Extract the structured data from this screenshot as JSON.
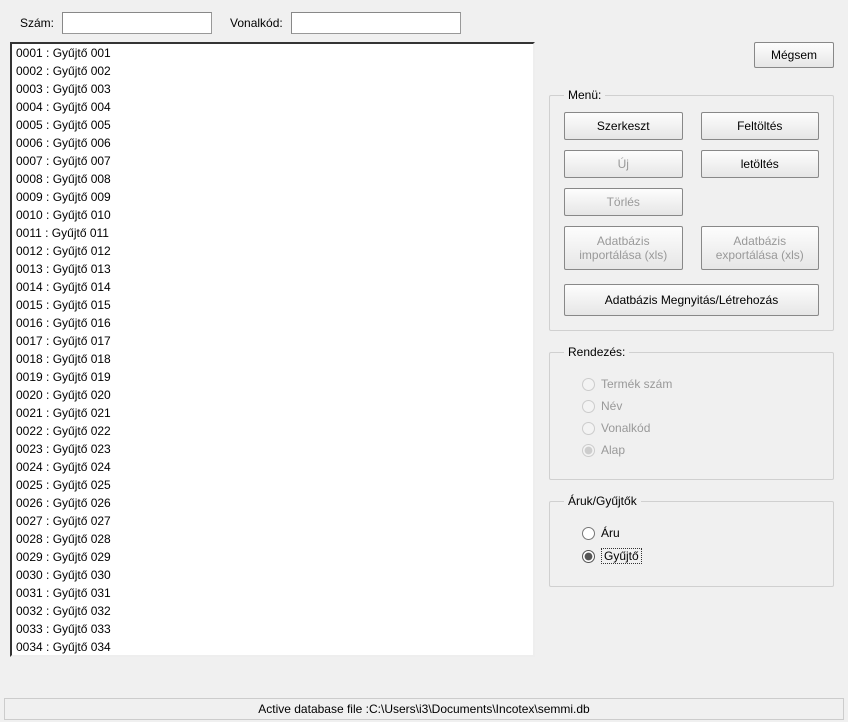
{
  "top": {
    "szam_label": "Szám:",
    "szam_value": "",
    "vonalkod_label": "Vonalkód:",
    "vonalkod_value": ""
  },
  "cancel_label": "Mégsem",
  "menu": {
    "legend": "Menü:",
    "szerkeszt": "Szerkeszt",
    "feltoltes": "Feltöltés",
    "uj": "Új",
    "letoltes": "letöltés",
    "torles": "Törlés",
    "import": "Adatbázis importálása (xls)",
    "export": "Adatbázis exportálása (xls)",
    "open_create": "Adatbázis Megnyitás/Létrehozás"
  },
  "rendezes": {
    "legend": "Rendezés:",
    "termek_szam": "Termék szám",
    "nev": "Név",
    "vonalkod": "Vonalkód",
    "alap": "Alap"
  },
  "aruk": {
    "legend": "Áruk/Gyűjtők",
    "aru": "Áru",
    "gyujto": "Gyűjtő"
  },
  "status": "Active database file :C:\\Users\\i3\\Documents\\Incotex\\semmi.db",
  "list_items": [
    "0001 : Gyűjtő 001",
    "0002 : Gyűjtő 002",
    "0003 : Gyűjtő 003",
    "0004 : Gyűjtő 004",
    "0005 : Gyűjtő 005",
    "0006 : Gyűjtő 006",
    "0007 : Gyűjtő 007",
    "0008 : Gyűjtő 008",
    "0009 : Gyűjtő 009",
    "0010 : Gyűjtő 010",
    "0011 : Gyűjtő 011",
    "0012 : Gyűjtő 012",
    "0013 : Gyűjtő 013",
    "0014 : Gyűjtő 014",
    "0015 : Gyűjtő 015",
    "0016 : Gyűjtő 016",
    "0017 : Gyűjtő 017",
    "0018 : Gyűjtő 018",
    "0019 : Gyűjtő 019",
    "0020 : Gyűjtő 020",
    "0021 : Gyűjtő 021",
    "0022 : Gyűjtő 022",
    "0023 : Gyűjtő 023",
    "0024 : Gyűjtő 024",
    "0025 : Gyűjtő 025",
    "0026 : Gyűjtő 026",
    "0027 : Gyűjtő 027",
    "0028 : Gyűjtő 028",
    "0029 : Gyűjtő 029",
    "0030 : Gyűjtő 030",
    "0031 : Gyűjtő 031",
    "0032 : Gyűjtő 032",
    "0033 : Gyűjtő 033",
    "0034 : Gyűjtő 034"
  ]
}
